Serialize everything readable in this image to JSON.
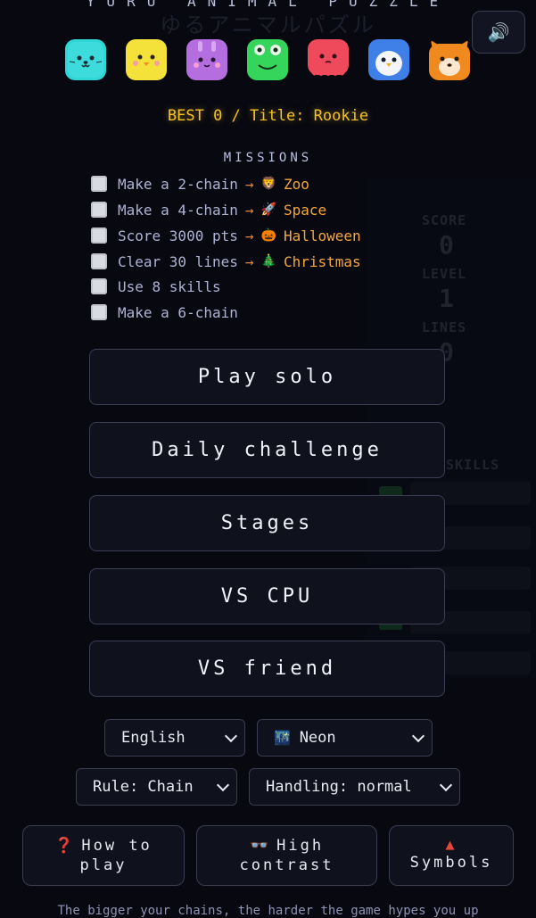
{
  "header": {
    "title": "YURU ANIMAL PUZZLE",
    "subtitle": "ゆるアニマルパズル",
    "sound_icon": "🔊"
  },
  "animals": [
    {
      "name": "cat",
      "color": "#2fd6d6"
    },
    {
      "name": "chick",
      "color": "#f4e23a"
    },
    {
      "name": "bunny",
      "color": "#b56ee0"
    },
    {
      "name": "frog",
      "color": "#35d45a"
    },
    {
      "name": "octopus",
      "color": "#ef4a5c"
    },
    {
      "name": "penguin",
      "color": "#3f7fe8"
    },
    {
      "name": "fox",
      "color": "#f08a1e"
    }
  ],
  "best_line": "BEST 0 / Title: Rookie",
  "missions": {
    "title": "MISSIONS",
    "items": [
      {
        "text": "Make a 2-chain",
        "arrow": "→",
        "reward_emoji": "🦁",
        "reward": "Zoo"
      },
      {
        "text": "Make a 4-chain",
        "arrow": "→",
        "reward_emoji": "🚀",
        "reward": "Space"
      },
      {
        "text": "Score 3000 pts",
        "arrow": "→",
        "reward_emoji": "🎃",
        "reward": "Halloween"
      },
      {
        "text": "Clear 30 lines",
        "arrow": "→",
        "reward_emoji": "🎄",
        "reward": "Christmas"
      },
      {
        "text": "Use 8 skills",
        "arrow": "",
        "reward_emoji": "",
        "reward": ""
      },
      {
        "text": "Make a 6-chain",
        "arrow": "",
        "reward_emoji": "",
        "reward": ""
      }
    ]
  },
  "background_panel": {
    "score_label": "SCORE",
    "score_value": "0",
    "level_label": "LEVEL",
    "level_value": "1",
    "lines_label": "LINES",
    "lines_value": "0",
    "skills_label": "SKILLS"
  },
  "menu": {
    "play_solo": "Play solo",
    "daily_challenge": "Daily challenge",
    "stages": "Stages",
    "vs_cpu": "VS CPU",
    "vs_friend": "VS friend"
  },
  "selects": {
    "language": "English",
    "theme_icon": "🌃",
    "theme": "Neon",
    "rule": "Rule: Chain",
    "handling": "Handling: normal"
  },
  "options": {
    "how_to_play_icon": "❓",
    "how_to_play_line1": "How to",
    "how_to_play_line2": "play",
    "high_contrast_icon": "👓",
    "high_contrast_line1": "High",
    "high_contrast_line2": "contrast",
    "symbols_icon": "▲",
    "symbols_label": "Symbols"
  },
  "footer": "The bigger your chains, the harder the game hypes you up"
}
